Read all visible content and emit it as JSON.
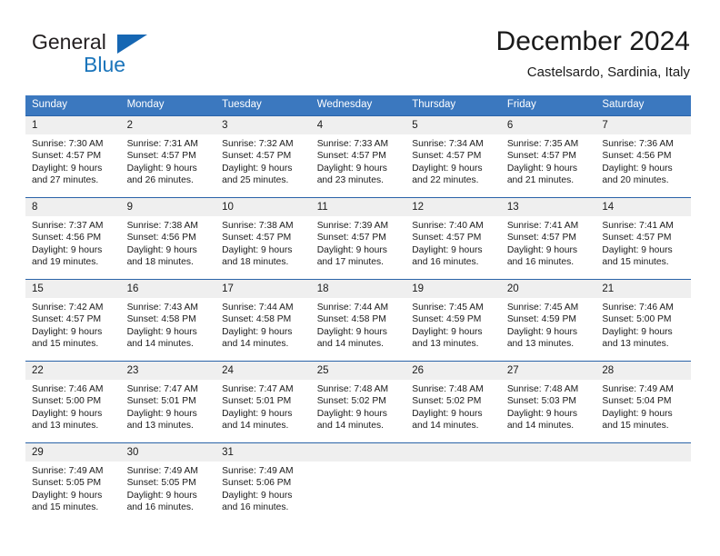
{
  "brand": {
    "name_part1": "General",
    "name_part2": "Blue",
    "triangle_color": "#1667b3",
    "blue_color": "#1b75bb"
  },
  "header": {
    "title": "December 2024",
    "location": "Castelsardo, Sardinia, Italy"
  },
  "theme": {
    "header_row_bg": "#3b78bf",
    "daynum_bg": "#efefef",
    "separator": "#2a63a8",
    "text": "#1a1a1a"
  },
  "weekday_headers": [
    "Sunday",
    "Monday",
    "Tuesday",
    "Wednesday",
    "Thursday",
    "Friday",
    "Saturday"
  ],
  "labels": {
    "sunrise_prefix": "Sunrise:",
    "sunset_prefix": "Sunset:",
    "daylight_prefix": "Daylight:"
  },
  "weeks": [
    [
      {
        "day": "1",
        "sunrise": "Sunrise: 7:30 AM",
        "sunset": "Sunset: 4:57 PM",
        "daylight_line1": "Daylight: 9 hours",
        "daylight_line2": "and 27 minutes."
      },
      {
        "day": "2",
        "sunrise": "Sunrise: 7:31 AM",
        "sunset": "Sunset: 4:57 PM",
        "daylight_line1": "Daylight: 9 hours",
        "daylight_line2": "and 26 minutes."
      },
      {
        "day": "3",
        "sunrise": "Sunrise: 7:32 AM",
        "sunset": "Sunset: 4:57 PM",
        "daylight_line1": "Daylight: 9 hours",
        "daylight_line2": "and 25 minutes."
      },
      {
        "day": "4",
        "sunrise": "Sunrise: 7:33 AM",
        "sunset": "Sunset: 4:57 PM",
        "daylight_line1": "Daylight: 9 hours",
        "daylight_line2": "and 23 minutes."
      },
      {
        "day": "5",
        "sunrise": "Sunrise: 7:34 AM",
        "sunset": "Sunset: 4:57 PM",
        "daylight_line1": "Daylight: 9 hours",
        "daylight_line2": "and 22 minutes."
      },
      {
        "day": "6",
        "sunrise": "Sunrise: 7:35 AM",
        "sunset": "Sunset: 4:57 PM",
        "daylight_line1": "Daylight: 9 hours",
        "daylight_line2": "and 21 minutes."
      },
      {
        "day": "7",
        "sunrise": "Sunrise: 7:36 AM",
        "sunset": "Sunset: 4:56 PM",
        "daylight_line1": "Daylight: 9 hours",
        "daylight_line2": "and 20 minutes."
      }
    ],
    [
      {
        "day": "8",
        "sunrise": "Sunrise: 7:37 AM",
        "sunset": "Sunset: 4:56 PM",
        "daylight_line1": "Daylight: 9 hours",
        "daylight_line2": "and 19 minutes."
      },
      {
        "day": "9",
        "sunrise": "Sunrise: 7:38 AM",
        "sunset": "Sunset: 4:56 PM",
        "daylight_line1": "Daylight: 9 hours",
        "daylight_line2": "and 18 minutes."
      },
      {
        "day": "10",
        "sunrise": "Sunrise: 7:38 AM",
        "sunset": "Sunset: 4:57 PM",
        "daylight_line1": "Daylight: 9 hours",
        "daylight_line2": "and 18 minutes."
      },
      {
        "day": "11",
        "sunrise": "Sunrise: 7:39 AM",
        "sunset": "Sunset: 4:57 PM",
        "daylight_line1": "Daylight: 9 hours",
        "daylight_line2": "and 17 minutes."
      },
      {
        "day": "12",
        "sunrise": "Sunrise: 7:40 AM",
        "sunset": "Sunset: 4:57 PM",
        "daylight_line1": "Daylight: 9 hours",
        "daylight_line2": "and 16 minutes."
      },
      {
        "day": "13",
        "sunrise": "Sunrise: 7:41 AM",
        "sunset": "Sunset: 4:57 PM",
        "daylight_line1": "Daylight: 9 hours",
        "daylight_line2": "and 16 minutes."
      },
      {
        "day": "14",
        "sunrise": "Sunrise: 7:41 AM",
        "sunset": "Sunset: 4:57 PM",
        "daylight_line1": "Daylight: 9 hours",
        "daylight_line2": "and 15 minutes."
      }
    ],
    [
      {
        "day": "15",
        "sunrise": "Sunrise: 7:42 AM",
        "sunset": "Sunset: 4:57 PM",
        "daylight_line1": "Daylight: 9 hours",
        "daylight_line2": "and 15 minutes."
      },
      {
        "day": "16",
        "sunrise": "Sunrise: 7:43 AM",
        "sunset": "Sunset: 4:58 PM",
        "daylight_line1": "Daylight: 9 hours",
        "daylight_line2": "and 14 minutes."
      },
      {
        "day": "17",
        "sunrise": "Sunrise: 7:44 AM",
        "sunset": "Sunset: 4:58 PM",
        "daylight_line1": "Daylight: 9 hours",
        "daylight_line2": "and 14 minutes."
      },
      {
        "day": "18",
        "sunrise": "Sunrise: 7:44 AM",
        "sunset": "Sunset: 4:58 PM",
        "daylight_line1": "Daylight: 9 hours",
        "daylight_line2": "and 14 minutes."
      },
      {
        "day": "19",
        "sunrise": "Sunrise: 7:45 AM",
        "sunset": "Sunset: 4:59 PM",
        "daylight_line1": "Daylight: 9 hours",
        "daylight_line2": "and 13 minutes."
      },
      {
        "day": "20",
        "sunrise": "Sunrise: 7:45 AM",
        "sunset": "Sunset: 4:59 PM",
        "daylight_line1": "Daylight: 9 hours",
        "daylight_line2": "and 13 minutes."
      },
      {
        "day": "21",
        "sunrise": "Sunrise: 7:46 AM",
        "sunset": "Sunset: 5:00 PM",
        "daylight_line1": "Daylight: 9 hours",
        "daylight_line2": "and 13 minutes."
      }
    ],
    [
      {
        "day": "22",
        "sunrise": "Sunrise: 7:46 AM",
        "sunset": "Sunset: 5:00 PM",
        "daylight_line1": "Daylight: 9 hours",
        "daylight_line2": "and 13 minutes."
      },
      {
        "day": "23",
        "sunrise": "Sunrise: 7:47 AM",
        "sunset": "Sunset: 5:01 PM",
        "daylight_line1": "Daylight: 9 hours",
        "daylight_line2": "and 13 minutes."
      },
      {
        "day": "24",
        "sunrise": "Sunrise: 7:47 AM",
        "sunset": "Sunset: 5:01 PM",
        "daylight_line1": "Daylight: 9 hours",
        "daylight_line2": "and 14 minutes."
      },
      {
        "day": "25",
        "sunrise": "Sunrise: 7:48 AM",
        "sunset": "Sunset: 5:02 PM",
        "daylight_line1": "Daylight: 9 hours",
        "daylight_line2": "and 14 minutes."
      },
      {
        "day": "26",
        "sunrise": "Sunrise: 7:48 AM",
        "sunset": "Sunset: 5:02 PM",
        "daylight_line1": "Daylight: 9 hours",
        "daylight_line2": "and 14 minutes."
      },
      {
        "day": "27",
        "sunrise": "Sunrise: 7:48 AM",
        "sunset": "Sunset: 5:03 PM",
        "daylight_line1": "Daylight: 9 hours",
        "daylight_line2": "and 14 minutes."
      },
      {
        "day": "28",
        "sunrise": "Sunrise: 7:49 AM",
        "sunset": "Sunset: 5:04 PM",
        "daylight_line1": "Daylight: 9 hours",
        "daylight_line2": "and 15 minutes."
      }
    ],
    [
      {
        "day": "29",
        "sunrise": "Sunrise: 7:49 AM",
        "sunset": "Sunset: 5:05 PM",
        "daylight_line1": "Daylight: 9 hours",
        "daylight_line2": "and 15 minutes."
      },
      {
        "day": "30",
        "sunrise": "Sunrise: 7:49 AM",
        "sunset": "Sunset: 5:05 PM",
        "daylight_line1": "Daylight: 9 hours",
        "daylight_line2": "and 16 minutes."
      },
      {
        "day": "31",
        "sunrise": "Sunrise: 7:49 AM",
        "sunset": "Sunset: 5:06 PM",
        "daylight_line1": "Daylight: 9 hours",
        "daylight_line2": "and 16 minutes."
      },
      {
        "day": "",
        "sunrise": "",
        "sunset": "",
        "daylight_line1": "",
        "daylight_line2": ""
      },
      {
        "day": "",
        "sunrise": "",
        "sunset": "",
        "daylight_line1": "",
        "daylight_line2": ""
      },
      {
        "day": "",
        "sunrise": "",
        "sunset": "",
        "daylight_line1": "",
        "daylight_line2": ""
      },
      {
        "day": "",
        "sunrise": "",
        "sunset": "",
        "daylight_line1": "",
        "daylight_line2": ""
      }
    ]
  ]
}
